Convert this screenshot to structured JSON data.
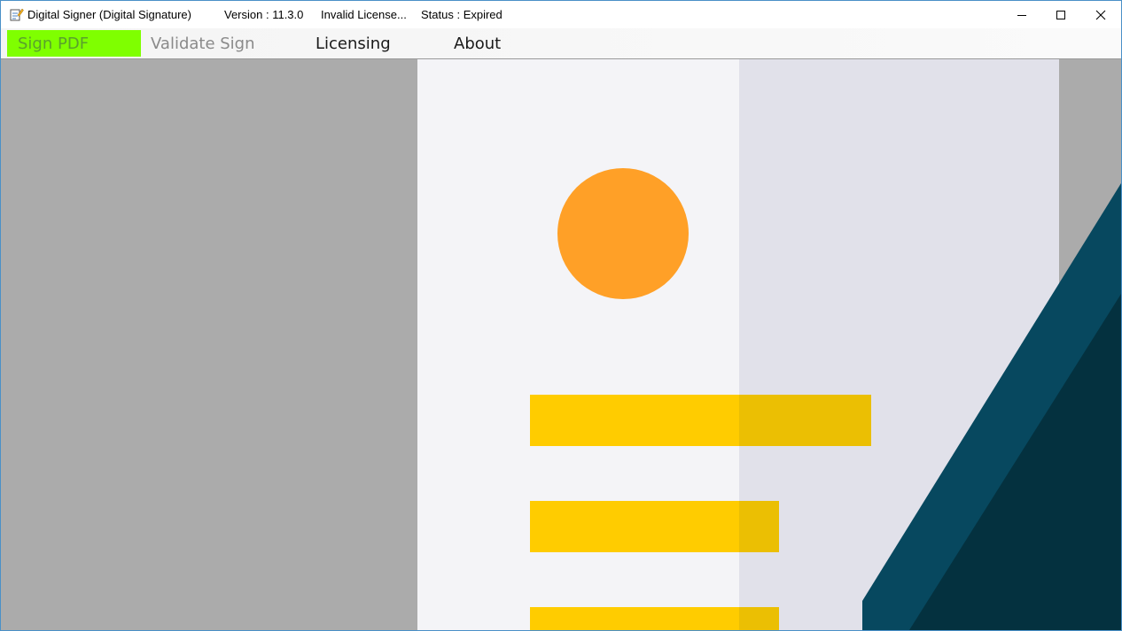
{
  "window": {
    "title": "Digital Signer (Digital Signature)",
    "version": "Version : 11.3.0",
    "license": "Invalid License...",
    "status": "Status : Expired"
  },
  "menu": {
    "sign_pdf": "Sign PDF",
    "validate_sign": "Validate Sign",
    "licensing": "Licensing",
    "about": "About"
  },
  "colors": {
    "active_menu_bg": "#7fff00",
    "orange_circle": "#ffa027",
    "yellow_bars": "#ffcc00",
    "pen_blue": "#07485f",
    "pen_dark": "#04313f",
    "document_light": "#f4f4f7",
    "document_shade": "#e1e1ea",
    "background_gray": "#ababab"
  },
  "icons": {
    "app": "notepad-pencil-icon",
    "minimize": "minimize-icon",
    "maximize": "maximize-icon",
    "close": "close-icon"
  }
}
